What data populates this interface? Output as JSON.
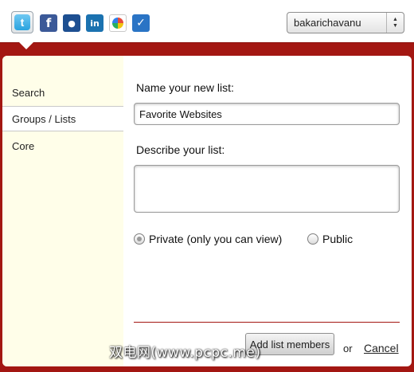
{
  "services": [
    {
      "name": "twitter",
      "glyph": "t"
    },
    {
      "name": "facebook",
      "glyph": "f"
    },
    {
      "name": "myspace",
      "glyph": "●"
    },
    {
      "name": "linkedin",
      "glyph": "in"
    },
    {
      "name": "google-buzz",
      "glyph": ""
    },
    {
      "name": "checkmark",
      "glyph": "✓"
    }
  ],
  "account": {
    "selected": "bakarichavanu"
  },
  "sidebar": {
    "items": [
      {
        "label": "Search"
      },
      {
        "label": "Groups / Lists"
      },
      {
        "label": "Core"
      }
    ]
  },
  "form": {
    "name_label": "Name your new list:",
    "name_value": "Favorite Websites",
    "describe_label": "Describe your list:",
    "describe_value": "",
    "private_label": "Private (only you can view)",
    "public_label": "Public",
    "add_button": "Add list members",
    "or_text": "or",
    "cancel_label": "Cancel"
  },
  "watermark": "双电网(www.pcpc.me)",
  "colors": {
    "frame": "#a31712",
    "sidebar_bg": "#fffee9",
    "twitter": "#2aa3df",
    "facebook": "#3b5998",
    "linkedin": "#1b72b0"
  }
}
